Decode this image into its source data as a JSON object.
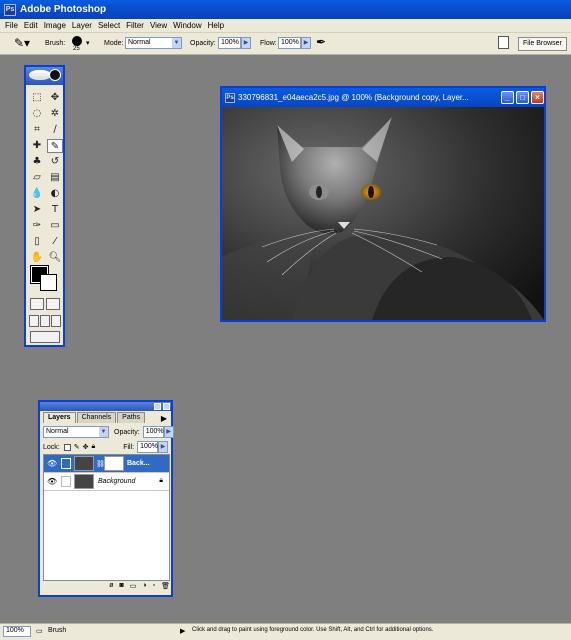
{
  "app": {
    "title": "Adobe Photoshop",
    "logo": "Ps"
  },
  "menu": [
    "File",
    "Edit",
    "Image",
    "Layer",
    "Select",
    "Filter",
    "View",
    "Window",
    "Help"
  ],
  "options": {
    "brush_label": "Brush:",
    "brush_size": "25",
    "mode_label": "Mode:",
    "mode_value": "Normal",
    "opacity_label": "Opacity:",
    "opacity_value": "100%",
    "flow_label": "Flow:",
    "flow_value": "100%",
    "file_browser": "File Browser"
  },
  "document": {
    "title": "330796831_e04aeca2c5.jpg @ 100% (Background copy, Layer...",
    "controls": {
      "minimize": "_",
      "maximize": "□",
      "close": "×"
    }
  },
  "layers_panel": {
    "tabs": [
      "Layers",
      "Channels",
      "Paths"
    ],
    "blend_mode": "Normal",
    "opacity_label": "Opacity:",
    "opacity_value": "100%",
    "lock_label": "Lock:",
    "fill_label": "Fill:",
    "fill_value": "100%",
    "layers": [
      {
        "name": "Back...",
        "selected": true
      },
      {
        "name": "Background",
        "selected": false
      }
    ]
  },
  "statusbar": {
    "zoom": "100%",
    "tool": "Brush",
    "hint": "Click and drag to paint using foreground color. Use Shift, Alt, and Ctrl for additional options."
  },
  "colors": {
    "xp_blue": "#0a3ed6",
    "workspace": "#7f7f7f",
    "panel": "#ece9d8",
    "selection": "#316ac5"
  }
}
